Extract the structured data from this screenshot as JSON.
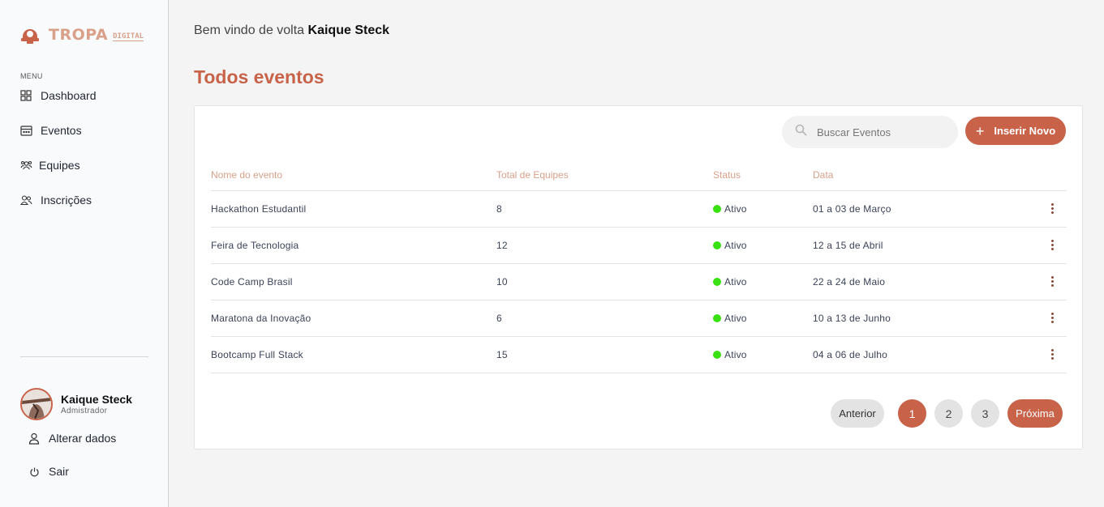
{
  "brand": {
    "logo_text": "TROPA",
    "logo_sub": "DIGITAL",
    "accent": "#c8634a"
  },
  "sidebar": {
    "menu_label": "MENU",
    "items": [
      {
        "label": "Dashboard",
        "icon": "grid-icon"
      },
      {
        "label": "Eventos",
        "icon": "calendar-icon"
      },
      {
        "label": "Equipes",
        "icon": "team-icon"
      },
      {
        "label": "Inscrições",
        "icon": "users-icon"
      }
    ],
    "user": {
      "name": "Kaique Steck",
      "role": "Admistrador"
    },
    "actions": [
      {
        "label": "Alterar dados",
        "icon": "user-icon"
      },
      {
        "label": "Sair",
        "icon": "power-icon"
      }
    ]
  },
  "header": {
    "welcome_prefix": "Bem vindo de volta",
    "welcome_name": "Kaique Steck",
    "title": "Todos eventos"
  },
  "toolbar": {
    "search_placeholder": "Buscar Eventos",
    "new_label": "Inserir Novo"
  },
  "table": {
    "columns": [
      "Nome do evento",
      "Total de Equipes",
      "Status",
      "Data"
    ],
    "rows": [
      {
        "name": "Hackathon Estudantil",
        "teams": "8",
        "status": "Ativo",
        "date": "01 a 03 de Março"
      },
      {
        "name": "Feira de Tecnologia",
        "teams": "12",
        "status": "Ativo",
        "date": "12 a 15 de Abril"
      },
      {
        "name": "Code Camp Brasil",
        "teams": "10",
        "status": "Ativo",
        "date": "22 a 24 de Maio"
      },
      {
        "name": "Maratona da Inovação",
        "teams": "6",
        "status": "Ativo",
        "date": "10 a 13 de Junho"
      },
      {
        "name": "Bootcamp Full Stack",
        "teams": "15",
        "status": "Ativo",
        "date": "04 a 06 de Julho"
      }
    ],
    "status_color": "#39e012"
  },
  "pagination": {
    "prev": "Anterior",
    "pages": [
      "1",
      "2",
      "3"
    ],
    "active_page": "1",
    "next": "Próxima"
  }
}
